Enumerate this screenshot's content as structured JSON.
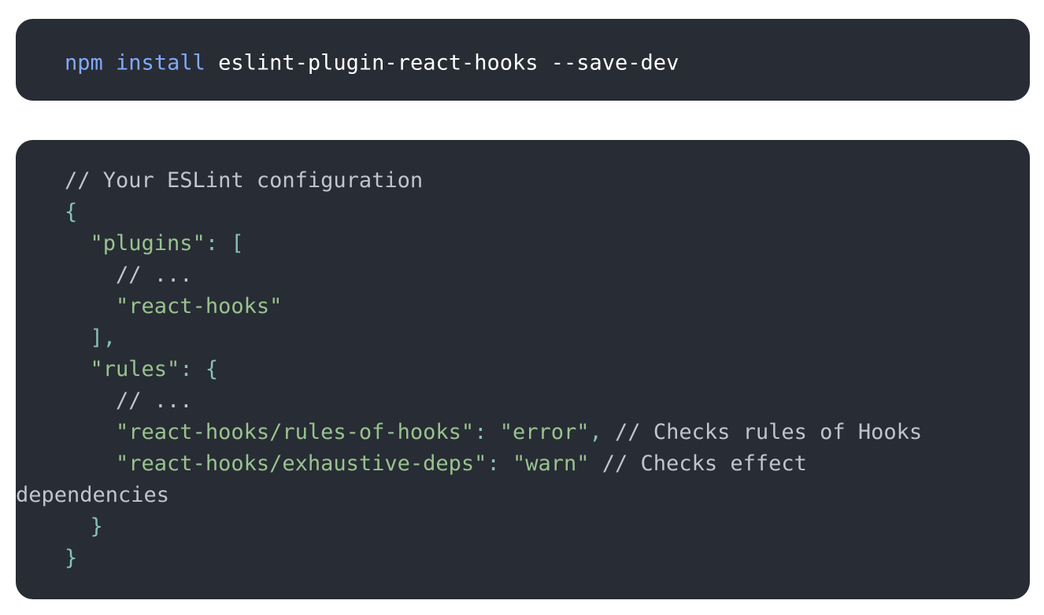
{
  "install_command": {
    "cmd": "npm",
    "subcmd": "install",
    "package": "eslint-plugin-react-hooks",
    "flag": "--save-dev"
  },
  "config": {
    "comment_header": "// Your ESLint configuration",
    "open_brace": "{",
    "plugins_key": "\"plugins\"",
    "plugins_colon": ":",
    "plugins_open": "[",
    "plugins_comment": "// ...",
    "plugins_value": "\"react-hooks\"",
    "plugins_close": "],",
    "rules_key": "\"rules\"",
    "rules_colon": ":",
    "rules_open": "{",
    "rules_comment": "// ...",
    "rule1_key": "\"react-hooks/rules-of-hooks\"",
    "rule1_colon": ":",
    "rule1_value": "\"error\"",
    "rule1_comma": ",",
    "rule1_comment": "// Checks rules of Hooks",
    "rule2_key": "\"react-hooks/exhaustive-deps\"",
    "rule2_colon": ":",
    "rule2_value": "\"warn\"",
    "rule2_comment": "// Checks effect",
    "rule2_comment_wrap": "dependencies",
    "rules_close": "}",
    "close_brace": "}"
  }
}
